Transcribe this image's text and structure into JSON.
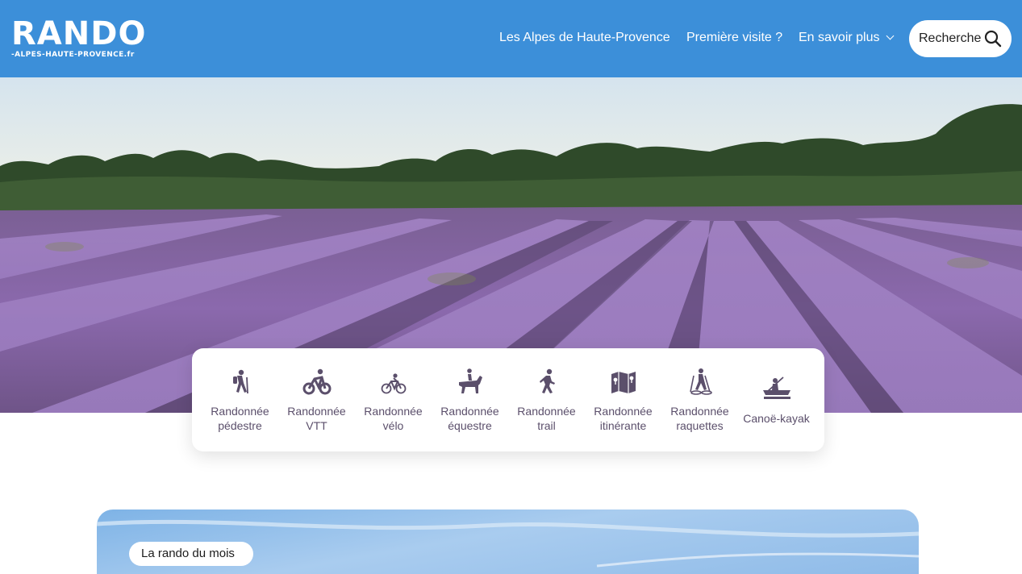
{
  "header": {
    "logo_main": "RANDO",
    "logo_sub": "-ALPES-HAUTE-PROVENCE.fr",
    "nav": [
      "Les Alpes de Haute-Provence",
      "Première visite ?",
      "En savoir plus"
    ],
    "search_label": "Recherche",
    "bg_color": "#3c8fd9"
  },
  "activities": [
    {
      "label": "Randonnée pédestre",
      "icon": "hiker-icon"
    },
    {
      "label": "Randonnée VTT",
      "icon": "mountain-bike-icon"
    },
    {
      "label": "Randonnée vélo",
      "icon": "bicycle-icon"
    },
    {
      "label": "Randonnée équestre",
      "icon": "horse-rider-icon"
    },
    {
      "label": "Randonnée trail",
      "icon": "trail-runner-icon"
    },
    {
      "label": "Randonnée itinérante",
      "icon": "map-icon"
    },
    {
      "label": "Randonnée raquettes",
      "icon": "snowshoe-icon"
    },
    {
      "label": "Canoë-kayak",
      "icon": "kayak-icon"
    }
  ],
  "feature": {
    "badge": "La rando du mois"
  },
  "colors": {
    "accent": "#3c8fd9",
    "icon": "#5b4f6b",
    "lavender": "#8a6aae"
  }
}
